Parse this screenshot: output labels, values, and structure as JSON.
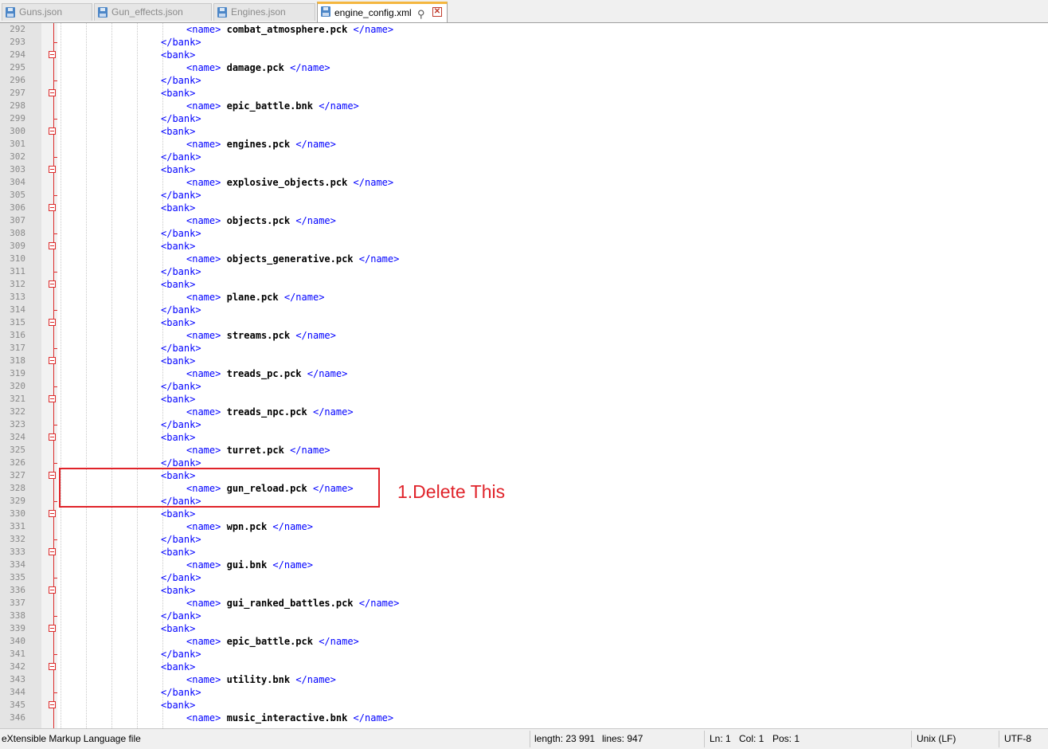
{
  "tabs": [
    {
      "label": "Guns.json",
      "active": false
    },
    {
      "label": "Gun_effects.json",
      "active": false
    },
    {
      "label": "Engines.json",
      "active": false
    },
    {
      "label": "engine_config.xml",
      "active": true
    }
  ],
  "tab_icons": {
    "save": "save-file-icon",
    "pin": "pin-icon",
    "close": "close-icon",
    "pin_glyph": "⚲",
    "close_glyph": "✕"
  },
  "editor": {
    "colors": {
      "tag": "#0000ff",
      "text": "#000000",
      "line_number": "#8a8a8a",
      "fold_marker": "#dc2a2a"
    },
    "lines": [
      {
        "n": "292",
        "tagOpen": "<name>",
        "text": "combat_atmosphere.pck",
        "tagClose": "</name>",
        "kind": "name"
      },
      {
        "n": "293",
        "tag": "</bank>",
        "kind": "close"
      },
      {
        "n": "294",
        "tag": "<bank>",
        "kind": "open"
      },
      {
        "n": "295",
        "tagOpen": "<name>",
        "text": "damage.pck",
        "tagClose": "</name>",
        "kind": "name"
      },
      {
        "n": "296",
        "tag": "</bank>",
        "kind": "close"
      },
      {
        "n": "297",
        "tag": "<bank>",
        "kind": "open"
      },
      {
        "n": "298",
        "tagOpen": "<name>",
        "text": "epic_battle.bnk",
        "tagClose": "</name>",
        "kind": "name"
      },
      {
        "n": "299",
        "tag": "</bank>",
        "kind": "close"
      },
      {
        "n": "300",
        "tag": "<bank>",
        "kind": "open"
      },
      {
        "n": "301",
        "tagOpen": "<name>",
        "text": "engines.pck",
        "tagClose": "</name>",
        "kind": "name"
      },
      {
        "n": "302",
        "tag": "</bank>",
        "kind": "close"
      },
      {
        "n": "303",
        "tag": "<bank>",
        "kind": "open"
      },
      {
        "n": "304",
        "tagOpen": "<name>",
        "text": "explosive_objects.pck",
        "tagClose": "</name>",
        "kind": "name"
      },
      {
        "n": "305",
        "tag": "</bank>",
        "kind": "close"
      },
      {
        "n": "306",
        "tag": "<bank>",
        "kind": "open"
      },
      {
        "n": "307",
        "tagOpen": "<name>",
        "text": "objects.pck",
        "tagClose": "</name>",
        "kind": "name"
      },
      {
        "n": "308",
        "tag": "</bank>",
        "kind": "close"
      },
      {
        "n": "309",
        "tag": "<bank>",
        "kind": "open"
      },
      {
        "n": "310",
        "tagOpen": "<name>",
        "text": "objects_generative.pck",
        "tagClose": "</name>",
        "kind": "name"
      },
      {
        "n": "311",
        "tag": "</bank>",
        "kind": "close"
      },
      {
        "n": "312",
        "tag": "<bank>",
        "kind": "open"
      },
      {
        "n": "313",
        "tagOpen": "<name>",
        "text": "plane.pck",
        "tagClose": "</name>",
        "kind": "name"
      },
      {
        "n": "314",
        "tag": "</bank>",
        "kind": "close"
      },
      {
        "n": "315",
        "tag": "<bank>",
        "kind": "open"
      },
      {
        "n": "316",
        "tagOpen": "<name>",
        "text": "streams.pck",
        "tagClose": "</name>",
        "kind": "name"
      },
      {
        "n": "317",
        "tag": "</bank>",
        "kind": "close"
      },
      {
        "n": "318",
        "tag": "<bank>",
        "kind": "open"
      },
      {
        "n": "319",
        "tagOpen": "<name>",
        "text": "treads_pc.pck",
        "tagClose": "</name>",
        "kind": "name"
      },
      {
        "n": "320",
        "tag": "</bank>",
        "kind": "close"
      },
      {
        "n": "321",
        "tag": "<bank>",
        "kind": "open"
      },
      {
        "n": "322",
        "tagOpen": "<name>",
        "text": "treads_npc.pck",
        "tagClose": "</name>",
        "kind": "name"
      },
      {
        "n": "323",
        "tag": "</bank>",
        "kind": "close"
      },
      {
        "n": "324",
        "tag": "<bank>",
        "kind": "open"
      },
      {
        "n": "325",
        "tagOpen": "<name>",
        "text": "turret.pck",
        "tagClose": "</name>",
        "kind": "name"
      },
      {
        "n": "326",
        "tag": "</bank>",
        "kind": "close"
      },
      {
        "n": "327",
        "tag": "<bank>",
        "kind": "open"
      },
      {
        "n": "328",
        "tagOpen": "<name>",
        "text": "gun_reload.pck",
        "tagClose": "</name>",
        "kind": "name"
      },
      {
        "n": "329",
        "tag": "</bank>",
        "kind": "close"
      },
      {
        "n": "330",
        "tag": "<bank>",
        "kind": "open"
      },
      {
        "n": "331",
        "tagOpen": "<name>",
        "text": "wpn.pck",
        "tagClose": "</name>",
        "kind": "name"
      },
      {
        "n": "332",
        "tag": "</bank>",
        "kind": "close"
      },
      {
        "n": "333",
        "tag": "<bank>",
        "kind": "open"
      },
      {
        "n": "334",
        "tagOpen": "<name>",
        "text": "gui.bnk",
        "tagClose": "</name>",
        "kind": "name"
      },
      {
        "n": "335",
        "tag": "</bank>",
        "kind": "close"
      },
      {
        "n": "336",
        "tag": "<bank>",
        "kind": "open"
      },
      {
        "n": "337",
        "tagOpen": "<name>",
        "text": "gui_ranked_battles.pck",
        "tagClose": "</name>",
        "kind": "name"
      },
      {
        "n": "338",
        "tag": "</bank>",
        "kind": "close"
      },
      {
        "n": "339",
        "tag": "<bank>",
        "kind": "open"
      },
      {
        "n": "340",
        "tagOpen": "<name>",
        "text": "epic_battle.pck",
        "tagClose": "</name>",
        "kind": "name"
      },
      {
        "n": "341",
        "tag": "</bank>",
        "kind": "close"
      },
      {
        "n": "342",
        "tag": "<bank>",
        "kind": "open"
      },
      {
        "n": "343",
        "tagOpen": "<name>",
        "text": "utility.bnk",
        "tagClose": "</name>",
        "kind": "name"
      },
      {
        "n": "344",
        "tag": "</bank>",
        "kind": "close"
      },
      {
        "n": "345",
        "tag": "<bank>",
        "kind": "open"
      },
      {
        "n": "346",
        "tagOpen": "<name>",
        "text": "music_interactive.bnk",
        "tagClose": "</name>",
        "kind": "name"
      }
    ]
  },
  "annotation": {
    "label": "1.Delete This",
    "color": "#e0232a"
  },
  "statusbar": {
    "file_type": "eXtensible Markup Language file",
    "length": "length: 23 991",
    "lines": "lines: 947",
    "ln": "Ln: 1",
    "col": "Col: 1",
    "pos": "Pos: 1",
    "eol": "Unix (LF)",
    "encoding": "UTF-8"
  }
}
